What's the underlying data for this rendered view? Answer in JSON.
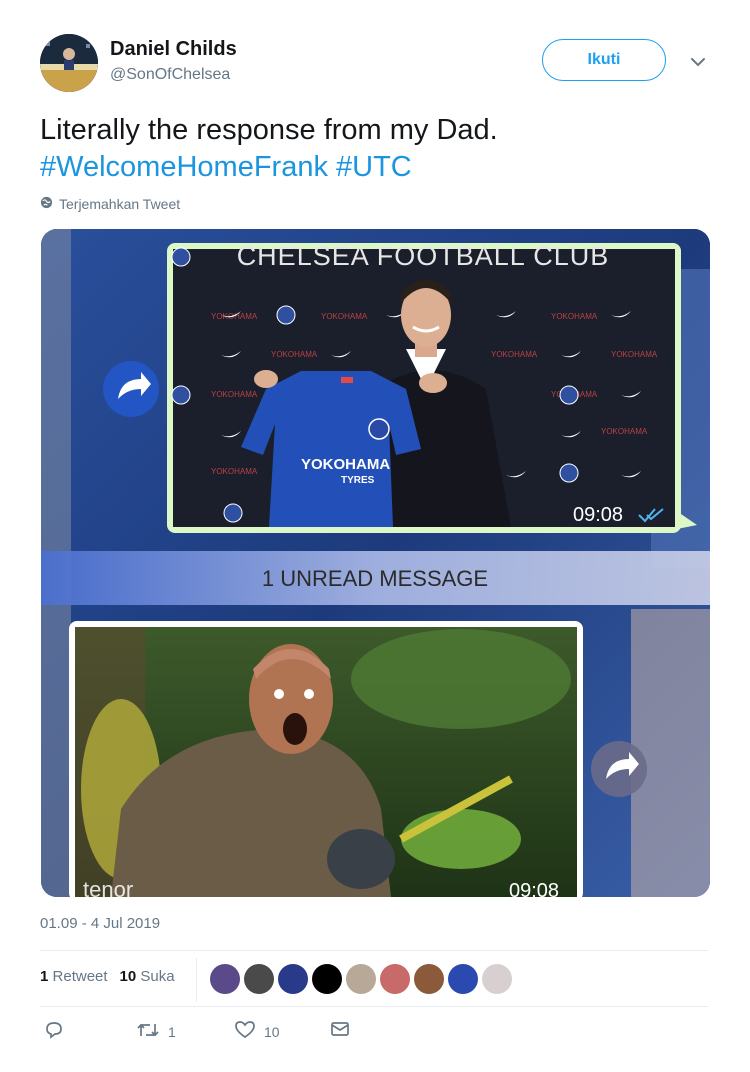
{
  "user": {
    "name": "Daniel Childs",
    "handle": "@SonOfChelsea",
    "follow_label": "Ikuti"
  },
  "tweet": {
    "text_plain": "Literally the response from my Dad.",
    "hashtag1": "#WelcomeHomeFrank",
    "hashtag2": "#UTC",
    "translate_label": "Terjemahkan Tweet",
    "timestamp": "01.09 - 4 Jul 2019"
  },
  "media": {
    "backdrop_title": "CHELSEA FOOTBALL CLUB",
    "sponsor": "YOKOHAMA",
    "sponsor_sub": "TYRES",
    "message1_time": "09:08",
    "unread_banner": "1 UNREAD MESSAGE",
    "gif_label": "tenor",
    "message2_time": "09:08"
  },
  "stats": {
    "retweets_count": "1",
    "retweets_label": "Retweet",
    "likes_count": "10",
    "likes_label": "Suka"
  },
  "actions": {
    "retweet_count": "1",
    "like_count": "10"
  },
  "colors": {
    "accent": "#1da1f2",
    "hashtag": "#1b95e0",
    "muted": "#657786",
    "chat_bubble": "#dcf8c6"
  }
}
